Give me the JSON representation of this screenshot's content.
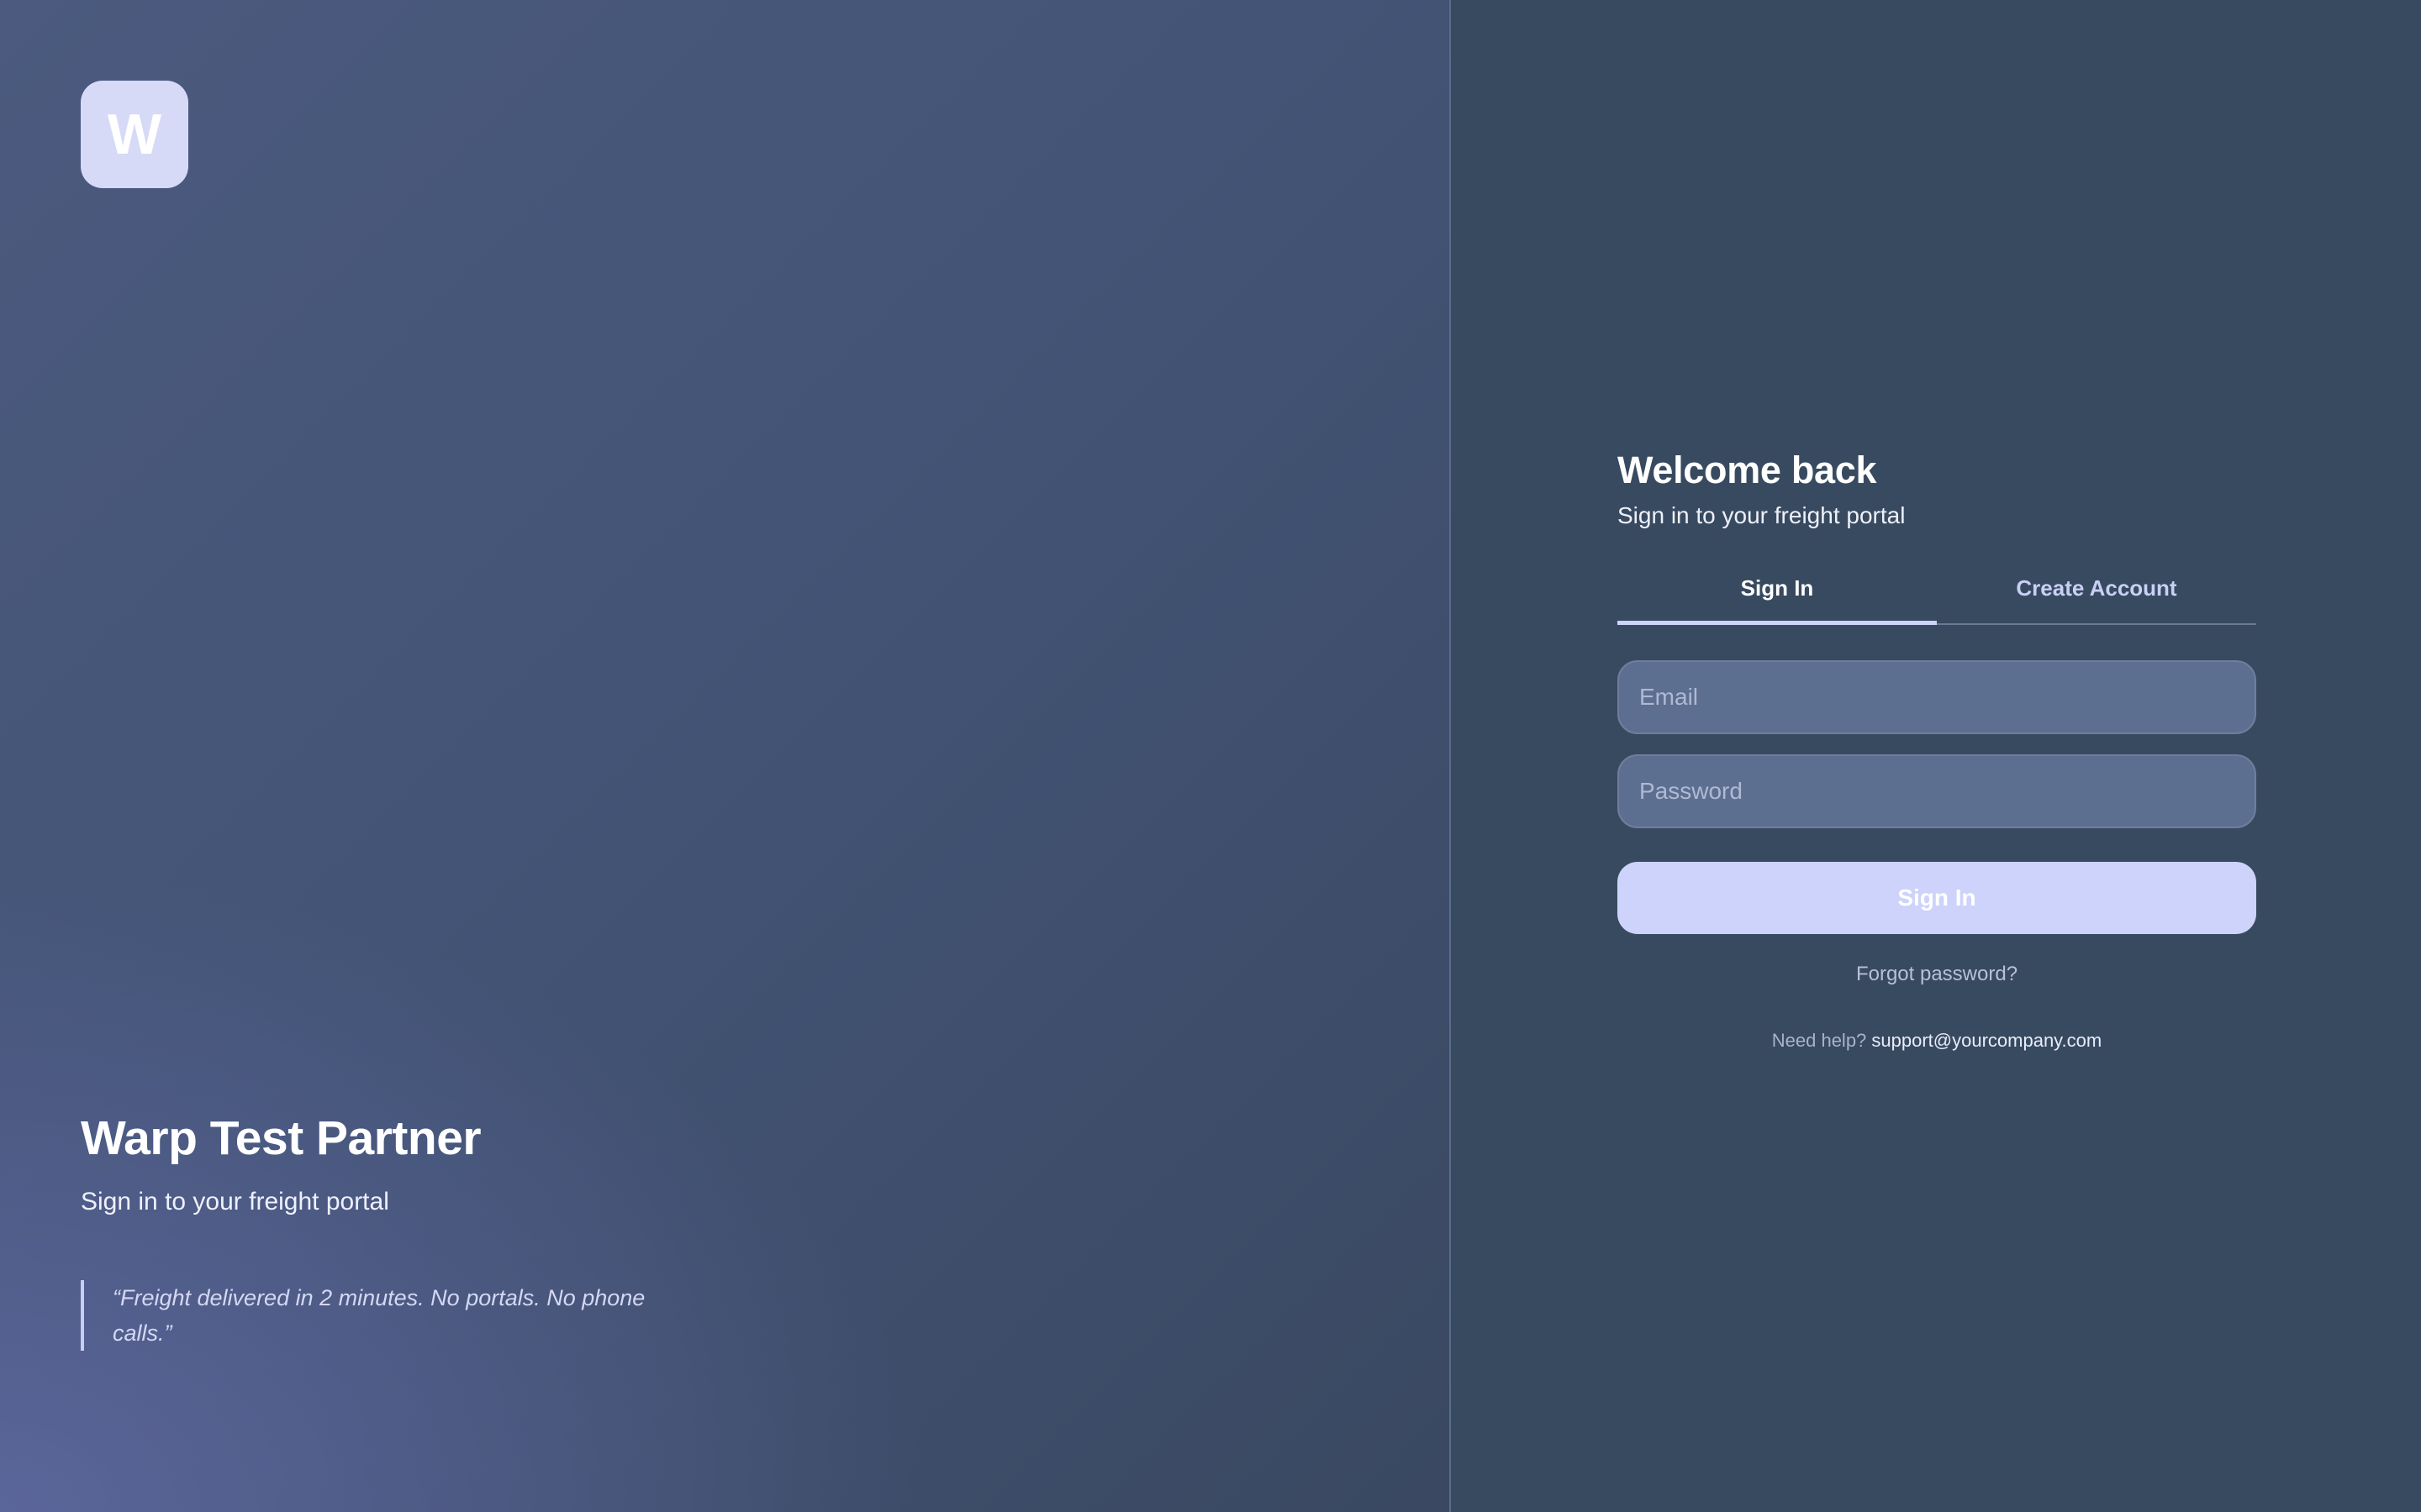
{
  "brand": {
    "logo_letter": "W",
    "title": "Warp Test Partner",
    "subtitle": "Sign in to your freight portal",
    "quote": "“Freight delivered in 2 minutes. No portals. No phone calls.”"
  },
  "form": {
    "title": "Welcome back",
    "subtitle": "Sign in to your freight portal",
    "tabs": [
      {
        "label": "Sign In",
        "active": true
      },
      {
        "label": "Create Account",
        "active": false
      }
    ],
    "email": {
      "value": "",
      "placeholder": "Email"
    },
    "password": {
      "value": "",
      "placeholder": "Password"
    },
    "submit_label": "Sign In",
    "forgot_label": "Forgot password?",
    "help_label": "Need help?",
    "help_email": "support@yourcompany.com"
  },
  "colors": {
    "accent": "#cdd3fb",
    "panel_bg": "#384a5f",
    "input_bg": "#5d6f90"
  }
}
